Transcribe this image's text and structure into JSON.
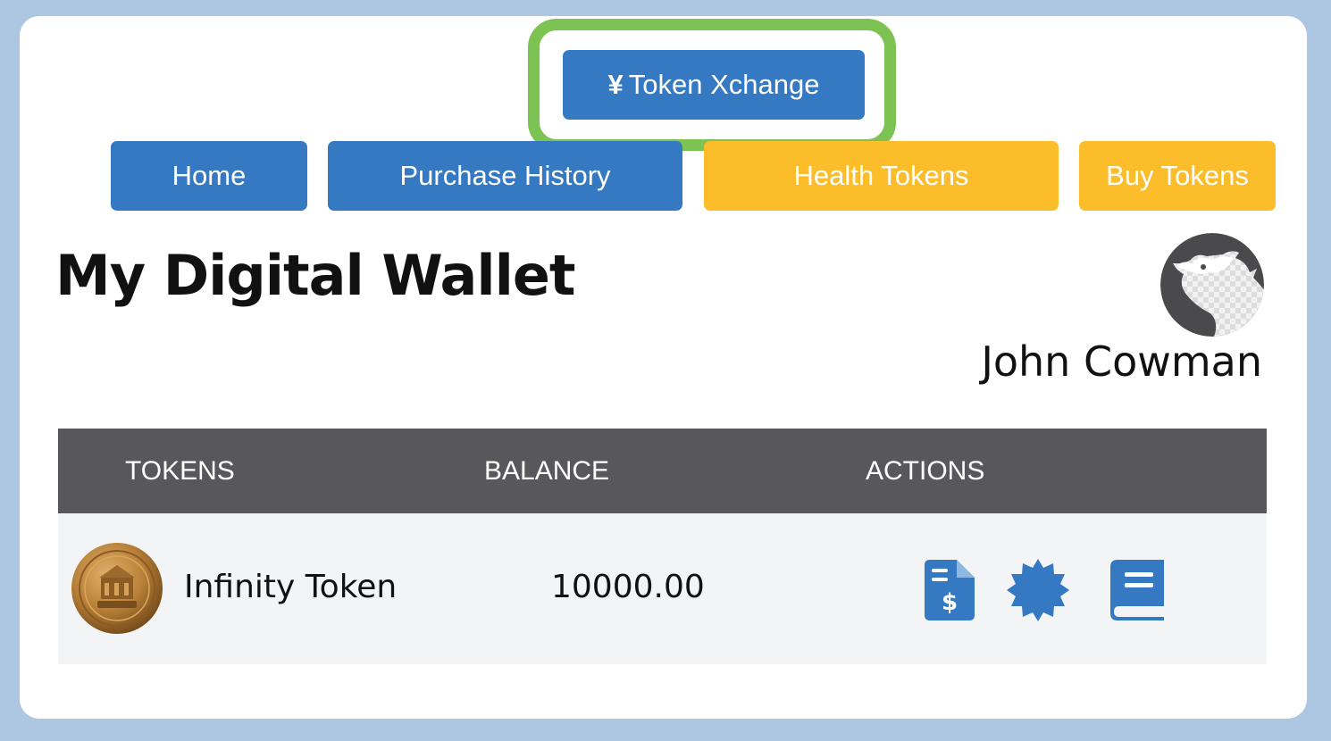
{
  "top_button": {
    "icon": "yen-icon",
    "icon_glyph": "¥",
    "label": "Token Xchange",
    "highlight_color": "#7cc353"
  },
  "nav": {
    "home": "Home",
    "purchase_history": "Purchase History",
    "health_tokens": "Health Tokens",
    "buy_tokens": "Buy Tokens"
  },
  "page": {
    "title": "My Digital Wallet"
  },
  "user": {
    "avatar_icon": "cow-avatar-icon",
    "name": "John Cowman"
  },
  "table": {
    "headers": [
      "TOKENS",
      "BALANCE",
      "ACTIONS"
    ],
    "rows": [
      {
        "token_icon": "infinity-coin-icon",
        "token": "Infinity Token",
        "balance": "10000.00",
        "actions": [
          "invoice-dollar-icon",
          "certificate-badge-icon",
          "book-icon"
        ]
      }
    ]
  },
  "colors": {
    "primary_blue": "#3479c2",
    "accent_yellow": "#fcbd2b",
    "table_header": "#58585a",
    "page_background": "#adc6e2"
  }
}
